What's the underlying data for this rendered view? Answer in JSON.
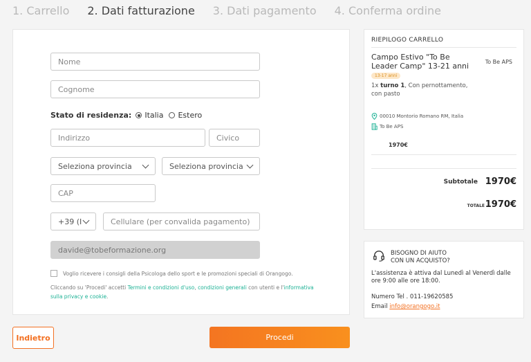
{
  "steps": [
    {
      "label": "1. Carrello",
      "state": "done"
    },
    {
      "label": "2. Dati fatturazione",
      "state": "active"
    },
    {
      "label": "3. Dati pagamento",
      "state": "pending"
    },
    {
      "label": "4. Conferma ordine",
      "state": "pending"
    }
  ],
  "form": {
    "first_name_placeholder": "Nome",
    "last_name_placeholder": "Cognome",
    "residence_label": "Stato di residenza:",
    "residence_options": [
      {
        "label": "Italia",
        "checked": true
      },
      {
        "label": "Estero",
        "checked": false
      }
    ],
    "address_placeholder": "Indirizzo",
    "street_number_placeholder": "Civico",
    "province_1_value": "Seleziona provincia",
    "province_2_value": "Seleziona provincia",
    "zip_placeholder": "CAP",
    "phone_prefix_value": "+39 (I",
    "mobile_placeholder": "Cellulare (per convalida pagamento)",
    "email_value": "davide@tobeformazione.org",
    "consent_text": "Voglio ricevere i consigli della Psicologa dello sport e le promozioni speciali di Orangogo.",
    "terms": {
      "prefix": "Cliccando su 'Procedi' accetti ",
      "link1": "Termini e condizioni d'uso",
      "sep": ", ",
      "link2": "condizioni generali",
      "middle": " con utenti e l'",
      "link3": "informativa sulla privacy e cookie",
      "suffix": "."
    }
  },
  "summary": {
    "title": "RIEPILOGO CARRELLO",
    "product_name": "Campo Estivo \"To Be Leader Camp\" 13-21 anni",
    "seller": "To Be APS",
    "age_badge": "13-17 anni",
    "qty": "1x",
    "turn": "turno 1",
    "options": ", Con pernottamento, con pasto",
    "location": "00010 Montorio Romano RM, Italia",
    "organizer": "To Be APS",
    "item_price": "1970€",
    "subtotal_label": "Subtotale",
    "subtotal_value": "1970€",
    "total_label": "TOTALE",
    "total_value": "1970€"
  },
  "help": {
    "title_line1": "BISOGNO DI AIUTO",
    "title_line2": "CON UN ACQUISTO?",
    "text": "L'assistenza è attiva dal Lunedì al Venerdì dalle ore 9:00 alle ore 18:00.",
    "phone": "Numero Tel . 011-19620585",
    "email_label": "Email ",
    "email": "info@orangogo.it"
  },
  "buttons": {
    "back_label": "Indietro",
    "next_label": "Procedi"
  },
  "colors": {
    "accent": "#f37021",
    "link_green": "#1bb194",
    "badge_bg": "#fde7c8"
  }
}
